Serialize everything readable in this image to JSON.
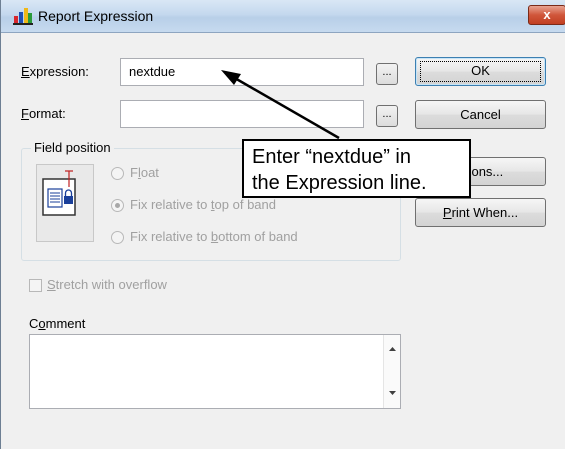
{
  "window": {
    "title": "Report Expression",
    "close_label": "x"
  },
  "expression": {
    "label_accel": "E",
    "label_rest": "xpression:",
    "value": "nextdue",
    "builder_label": "..."
  },
  "format": {
    "label_accel": "F",
    "label_rest": "ormat:",
    "value": "",
    "builder_label": "..."
  },
  "buttons": {
    "ok": "OK",
    "cancel": "Cancel",
    "calculations": "ations...",
    "print_when_accel": "P",
    "print_when_rest": "rint When..."
  },
  "field_position": {
    "title": "Field position",
    "options": [
      {
        "pre": "F",
        "accel": "l",
        "post": "oat",
        "selected": false
      },
      {
        "pre": "Fix relative to ",
        "accel": "t",
        "post": "op of band",
        "selected": true
      },
      {
        "pre": "Fix relative to ",
        "accel": "b",
        "post": "ottom of band",
        "selected": false
      }
    ]
  },
  "stretch": {
    "accel": "S",
    "rest": "tretch with overflow",
    "checked": false
  },
  "comment": {
    "label_pre": "C",
    "label_accel": "o",
    "label_rest": "mment",
    "value": ""
  },
  "callout": {
    "line1": "Enter “nextdue” in",
    "line2": "the Expression line."
  },
  "colors": {
    "titlebar": "#c4d8ee",
    "close": "#c13f22",
    "dialog_bg": "#f0f0f0",
    "default_border": "#3c7fb1"
  }
}
